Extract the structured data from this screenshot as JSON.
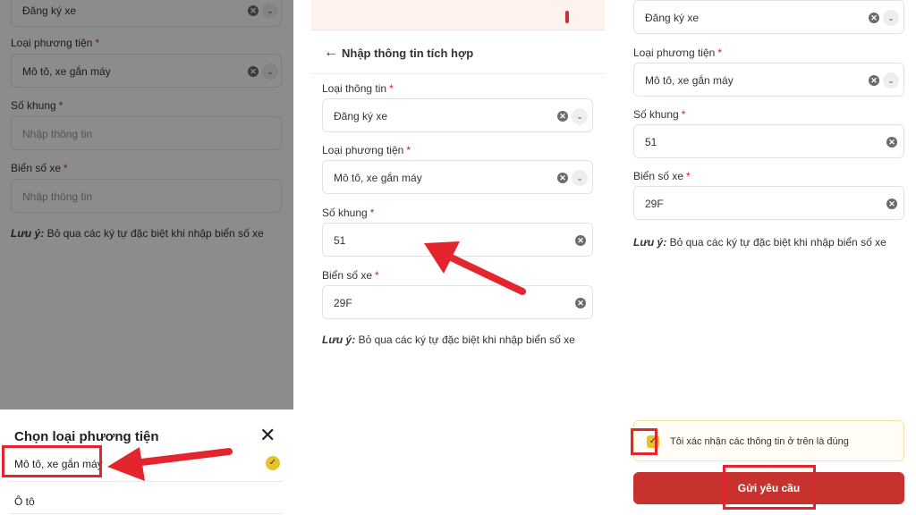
{
  "colors": {
    "brand_red": "#c7312e",
    "accent_yellow": "#e9c12a",
    "annotation_red": "#e3262e"
  },
  "panel1": {
    "vehicle_reg_value": "Đăng ký xe",
    "vehicle_type_label": "Loại phương tiện",
    "vehicle_type_value": "Mô tô, xe gắn máy",
    "frame_label": "Số khung",
    "frame_placeholder": "Nhập thông tin",
    "plate_label": "Biển số xe",
    "plate_placeholder": "Nhập thông tin",
    "note_prefix": "Lưu ý:",
    "note_text": " Bỏ qua các ký tự đặc biệt khi nhập biển số xe",
    "required_mark": "*",
    "sheet": {
      "title": "Chọn loại phương tiện",
      "close_icon": "close-icon",
      "options": [
        "Mô tô, xe gắn máy",
        "Ô tô"
      ],
      "selected_icon": "check-circle-icon"
    }
  },
  "panel2": {
    "page_title": "Nhập thông tin tích hợp",
    "back_icon": "arrow-left-icon",
    "info_type_label": "Loại thông tin",
    "info_type_value": "Đăng ký xe",
    "vehicle_type_label": "Loại phương tiện",
    "vehicle_type_value": "Mô tô, xe gắn máy",
    "frame_label": "Số khung",
    "frame_value": "51",
    "plate_label": "Biển số xe",
    "plate_value": "29F",
    "note_prefix": "Lưu ý:",
    "note_text": " Bỏ qua các ký tự đặc biệt khi nhập biển số xe",
    "required_mark": "*"
  },
  "panel3": {
    "info_type_value": "Đăng ký xe",
    "vehicle_type_label": "Loại phương tiện",
    "vehicle_type_value": "Mô tô, xe gắn máy",
    "frame_label": "Số khung",
    "frame_value": "51",
    "plate_label": "Biển số xe",
    "plate_value": "29F",
    "note_prefix": "Lưu ý:",
    "note_text": " Bỏ qua các ký tự đặc biệt khi nhập biển số xe",
    "required_mark": "*",
    "confirm_text": "Tôi xác nhận các thông tin ở trên là đúng",
    "submit_label": "Gửi yêu cầu"
  },
  "icons": {
    "clear": "✕",
    "chevron": "⌄",
    "check": "✓",
    "close": "✕",
    "back": "←"
  }
}
